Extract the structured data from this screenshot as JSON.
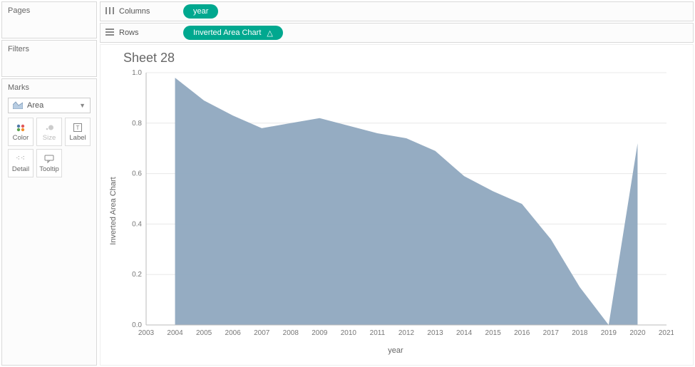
{
  "left": {
    "pages_title": "Pages",
    "filters_title": "Filters",
    "marks_title": "Marks",
    "mark_type": "Area",
    "buttons": {
      "color": "Color",
      "size": "Size",
      "label": "Label",
      "detail": "Detail",
      "tooltip": "Tooltip"
    }
  },
  "shelves": {
    "columns_label": "Columns",
    "rows_label": "Rows",
    "columns_pill": "year",
    "rows_pill": "Inverted Area Chart"
  },
  "sheet_title": "Sheet 28",
  "chart_data": {
    "type": "area",
    "title": "",
    "xlabel": "year",
    "ylabel": "Inverted Area Chart",
    "xlim": [
      2003,
      2021
    ],
    "ylim": [
      0,
      1.0
    ],
    "x_ticks": [
      2003,
      2004,
      2005,
      2006,
      2007,
      2008,
      2009,
      2010,
      2011,
      2012,
      2013,
      2014,
      2015,
      2016,
      2017,
      2018,
      2019,
      2020,
      2021
    ],
    "y_ticks": [
      0.0,
      0.2,
      0.4,
      0.6,
      0.8,
      1.0
    ],
    "categories": [
      2004,
      2005,
      2006,
      2007,
      2008,
      2009,
      2010,
      2011,
      2012,
      2013,
      2014,
      2015,
      2016,
      2017,
      2018,
      2019,
      2020
    ],
    "values": [
      0.98,
      0.89,
      0.83,
      0.78,
      0.8,
      0.82,
      0.79,
      0.76,
      0.74,
      0.69,
      0.59,
      0.53,
      0.48,
      0.34,
      0.15,
      0.0,
      0.72
    ],
    "fill_color": "#8fa8bf",
    "grid": true
  }
}
